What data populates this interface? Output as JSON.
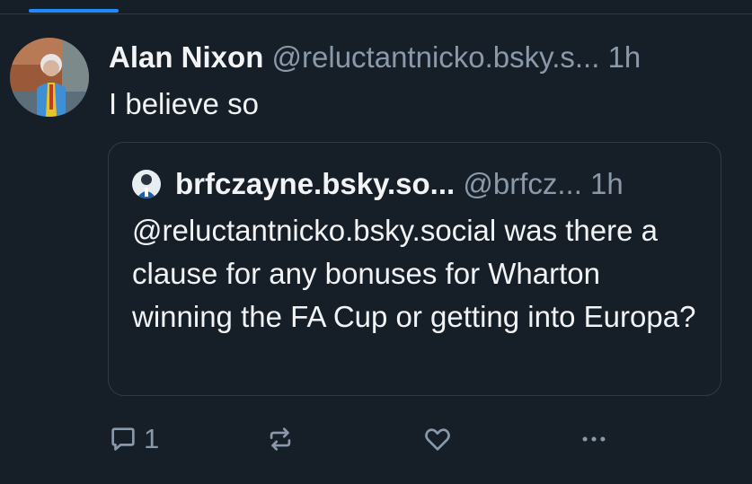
{
  "post": {
    "author_name": "Alan Nixon",
    "author_handle": "@reluctantnicko.bsky.s...",
    "time": "1h",
    "text": "I believe so",
    "avatar_icon": "user-avatar-photo"
  },
  "quote": {
    "author_name": "brfczayne.bsky.so...",
    "author_handle": "@brfcz...",
    "time": "1h",
    "text": "@reluctantnicko.bsky.social was there a clause for any bonuses for Wharton winning the FA Cup or getting into Europa?",
    "avatar_icon": "user-avatar-photo"
  },
  "actions": {
    "reply_count": "1",
    "reply_icon": "reply-icon",
    "repost_icon": "repost-icon",
    "like_icon": "heart-icon",
    "more_icon": "more-icon"
  },
  "colors": {
    "background": "#161e27",
    "accent": "#208bfe",
    "muted_text": "#8a99aa",
    "border": "#2e3c4a"
  }
}
